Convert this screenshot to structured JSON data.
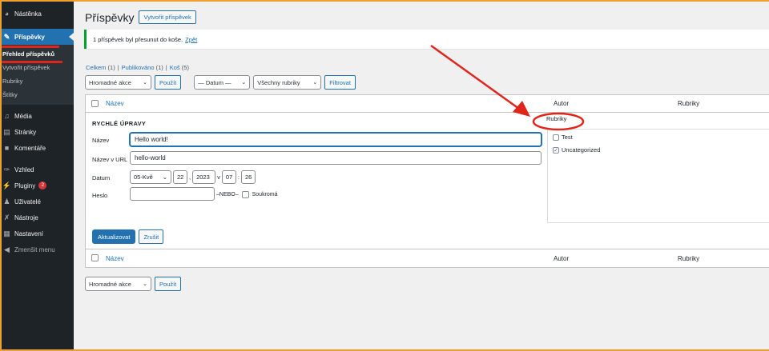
{
  "sidebar": {
    "items": [
      {
        "label": "Nástěnka",
        "icon": "dashboard-icon"
      },
      {
        "label": "Příspěvky",
        "icon": "pin-icon"
      },
      {
        "label": "Média",
        "icon": "media-icon"
      },
      {
        "label": "Stránky",
        "icon": "page-icon"
      },
      {
        "label": "Komentáře",
        "icon": "comment-icon"
      },
      {
        "label": "Vzhled",
        "icon": "brush-icon"
      },
      {
        "label": "Pluginy",
        "icon": "plugin-icon",
        "badge": "2"
      },
      {
        "label": "Uživatelé",
        "icon": "user-icon"
      },
      {
        "label": "Nástroje",
        "icon": "wrench-icon"
      },
      {
        "label": "Nastavení",
        "icon": "settings-icon"
      },
      {
        "label": "Zmenšit menu",
        "icon": "collapse-icon"
      }
    ],
    "submenu": [
      "Přehled příspěvků",
      "Vytvořit příspěvek",
      "Rubriky",
      "Štítky"
    ]
  },
  "header": {
    "title": "Příspěvky",
    "add_new": "Vytvořit příspěvek"
  },
  "notice": {
    "text": "1 příspěvek byl přesunut do koše.",
    "link": "Zpět"
  },
  "views": {
    "all": "Celkem",
    "all_count": "(1)",
    "published": "Publikováno",
    "published_count": "(1)",
    "trash": "Koš",
    "trash_count": "(5)",
    "sep": "|"
  },
  "tablenav": {
    "bulk": "Hromadné akce",
    "apply": "Použít",
    "date": "— Datum —",
    "category": "Všechny rubriky",
    "filter": "Filtrovat"
  },
  "table": {
    "col_name": "Název",
    "col_author": "Autor",
    "col_categories": "Rubriky"
  },
  "quick_edit": {
    "title": "RYCHLÉ ÚPRAVY",
    "name_label": "Název",
    "name_value": "Hello world!",
    "slug_label": "Název v URL",
    "slug_value": "hello-world",
    "date_label": "Datum",
    "month": "05-Kvě",
    "day": "22",
    "comma": ",",
    "year": "2023",
    "at": "v",
    "hour": "07",
    "colon": ":",
    "minute": "26",
    "password_label": "Heslo",
    "or": "–NEBO–",
    "private": "Soukromá",
    "categories_label": "Rubriky",
    "categories": [
      {
        "name": "Test",
        "checked": false
      },
      {
        "name": "Uncategorized",
        "checked": true
      }
    ],
    "update": "Aktualizovat",
    "cancel": "Zrušit"
  },
  "colors": {
    "accent": "#2271b1",
    "sidebar": "#1d2327",
    "annotation": "#e0261a",
    "success": "#00a32a"
  }
}
